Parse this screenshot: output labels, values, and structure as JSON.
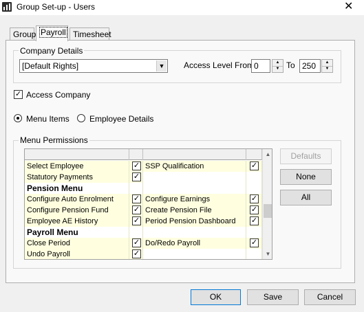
{
  "window": {
    "title": "Group Set-up - Users",
    "close_glyph": "✕"
  },
  "tabs": [
    {
      "label": "Group"
    },
    {
      "label": "Payroll"
    },
    {
      "label": "Timesheet"
    }
  ],
  "company_details": {
    "label": "Company Details",
    "rights_value": "[Default Rights]",
    "access_level_from_label": "Access Level From",
    "from_value": "0",
    "to_label": "To",
    "to_value": "250"
  },
  "access_company": {
    "label": "Access Company",
    "checked": true
  },
  "view_options": {
    "menu_items_label": "Menu Items",
    "employee_details_label": "Employee Details",
    "selected": "menu_items"
  },
  "menu_permissions": {
    "label": "Menu Permissions",
    "rows": [
      {
        "left": "Select Employee",
        "left_checked": true,
        "right": "SSP Qualification",
        "right_checked": true,
        "type": "item"
      },
      {
        "left": "Statutory Payments",
        "left_checked": true,
        "right": "",
        "right_checked": false,
        "type": "item"
      },
      {
        "left": "Pension Menu",
        "type": "header"
      },
      {
        "left": "Configure Auto Enrolment",
        "left_checked": true,
        "right": "Configure Earnings",
        "right_checked": true,
        "type": "item"
      },
      {
        "left": "Configure Pension Fund",
        "left_checked": true,
        "right": "Create Pension File",
        "right_checked": true,
        "type": "item"
      },
      {
        "left": "Employee AE History",
        "left_checked": true,
        "right": "Period Pension Dashboard",
        "right_checked": true,
        "type": "item"
      },
      {
        "left": "Payroll Menu",
        "type": "header"
      },
      {
        "left": "Close Period",
        "left_checked": true,
        "right": "Do/Redo Payroll",
        "right_checked": true,
        "type": "item"
      },
      {
        "left": "Undo Payroll",
        "left_checked": true,
        "right": "",
        "right_checked": false,
        "type": "item"
      }
    ]
  },
  "side_buttons": {
    "defaults": "Defaults",
    "none": "None",
    "all": "All"
  },
  "footer_buttons": {
    "ok": "OK",
    "save": "Save",
    "cancel": "Cancel"
  }
}
